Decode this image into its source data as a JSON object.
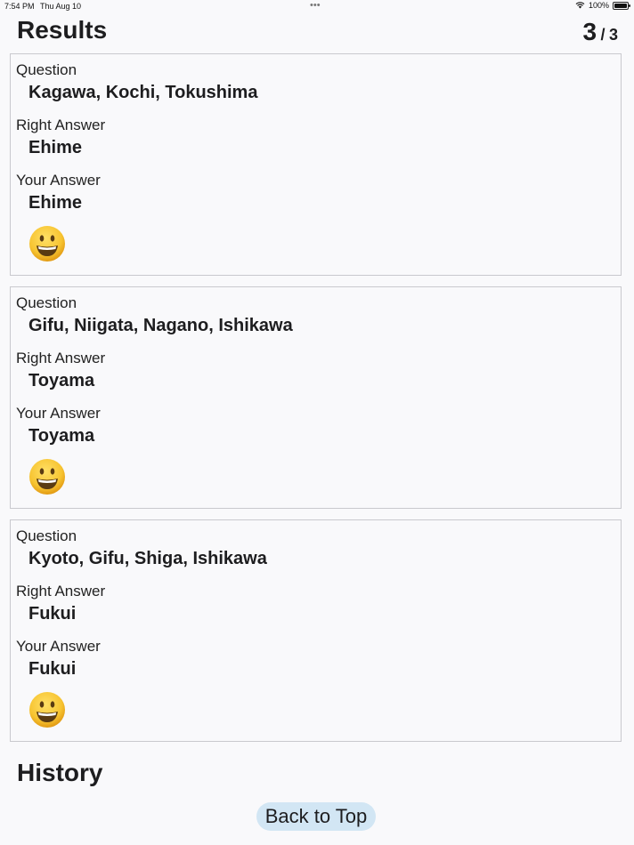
{
  "status_bar": {
    "time": "7:54 PM",
    "date": "Thu Aug 10",
    "battery": "100%",
    "battery_level": 1.0
  },
  "header": {
    "title": "Results",
    "score_correct": "3",
    "score_separator": "/",
    "score_total": "3"
  },
  "labels": {
    "question": "Question",
    "right_answer": "Right Answer",
    "your_answer": "Your Answer"
  },
  "results": [
    {
      "question": "Kagawa, Kochi, Tokushima",
      "right_answer": "Ehime",
      "your_answer": "Ehime",
      "verdict_icon": "smiling-face-icon"
    },
    {
      "question": "Gifu, Niigata, Nagano, Ishikawa",
      "right_answer": "Toyama",
      "your_answer": "Toyama",
      "verdict_icon": "smiling-face-icon"
    },
    {
      "question": "Kyoto, Gifu, Shiga, Ishikawa",
      "right_answer": "Fukui",
      "your_answer": "Fukui",
      "verdict_icon": "smiling-face-icon"
    }
  ],
  "history": {
    "title": "History"
  },
  "footer": {
    "back_label": "Back to Top"
  },
  "colors": {
    "background": "#f9f9fb",
    "card_border": "#c9c9ce",
    "button_bg": "#d2e6f4",
    "emoji_yellow": "#f7c431"
  }
}
